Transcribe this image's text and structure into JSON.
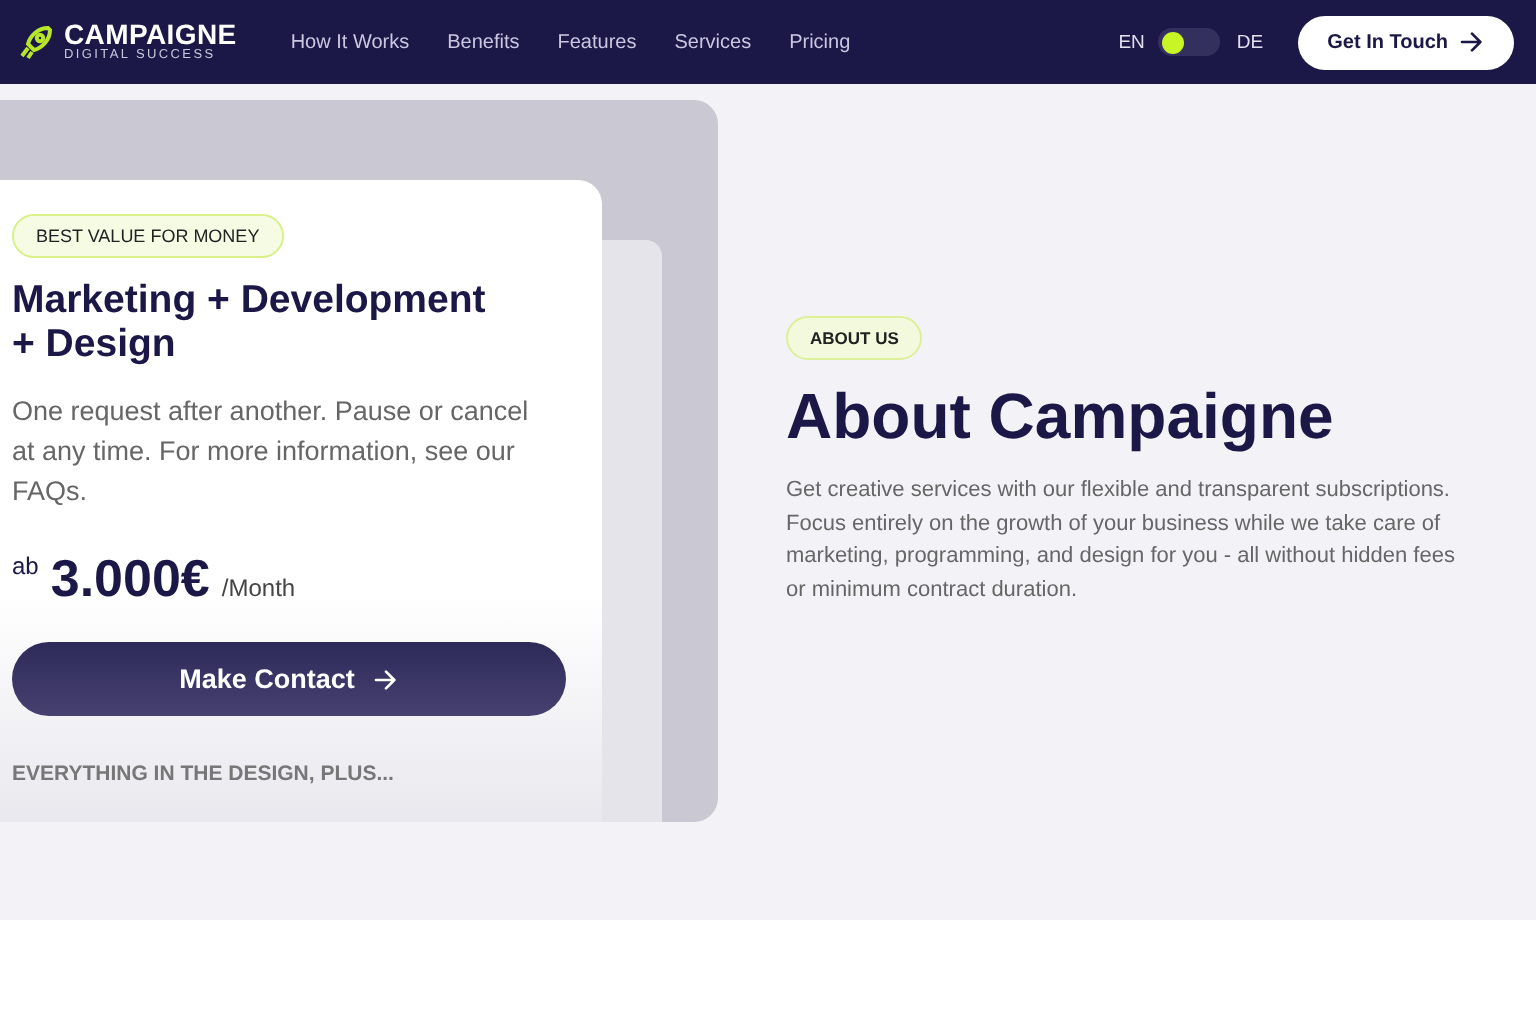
{
  "nav": {
    "logo": {
      "name": "CAMPAIGNE",
      "tagline": "DIGITAL SUCCESS"
    },
    "links": [
      "How It Works",
      "Benefits",
      "Features",
      "Services",
      "Pricing"
    ],
    "languages": [
      "EN",
      "DE"
    ],
    "language_switch": {
      "on": false
    },
    "cta": "Get In Touch"
  },
  "pricing_card": {
    "badge": "BEST VALUE FOR MONEY",
    "title": "Marketing + Development + Design",
    "description": "One request after another. Pause or cancel at any time. For more information, see our FAQs.",
    "price_prefix": "ab",
    "price": "3.000€",
    "period": "/Month",
    "button": "Make Contact",
    "footer": "EVERYTHING IN THE DESIGN, PLUS..."
  },
  "about": {
    "badge": "ABOUT US",
    "title": "About Campaigne",
    "text": "Get creative services with our flexible and transparent subscriptions. Focus entirely on the growth of your business while we take care of marketing, programming, and design for you - all without hidden fees or minimum contract duration."
  }
}
